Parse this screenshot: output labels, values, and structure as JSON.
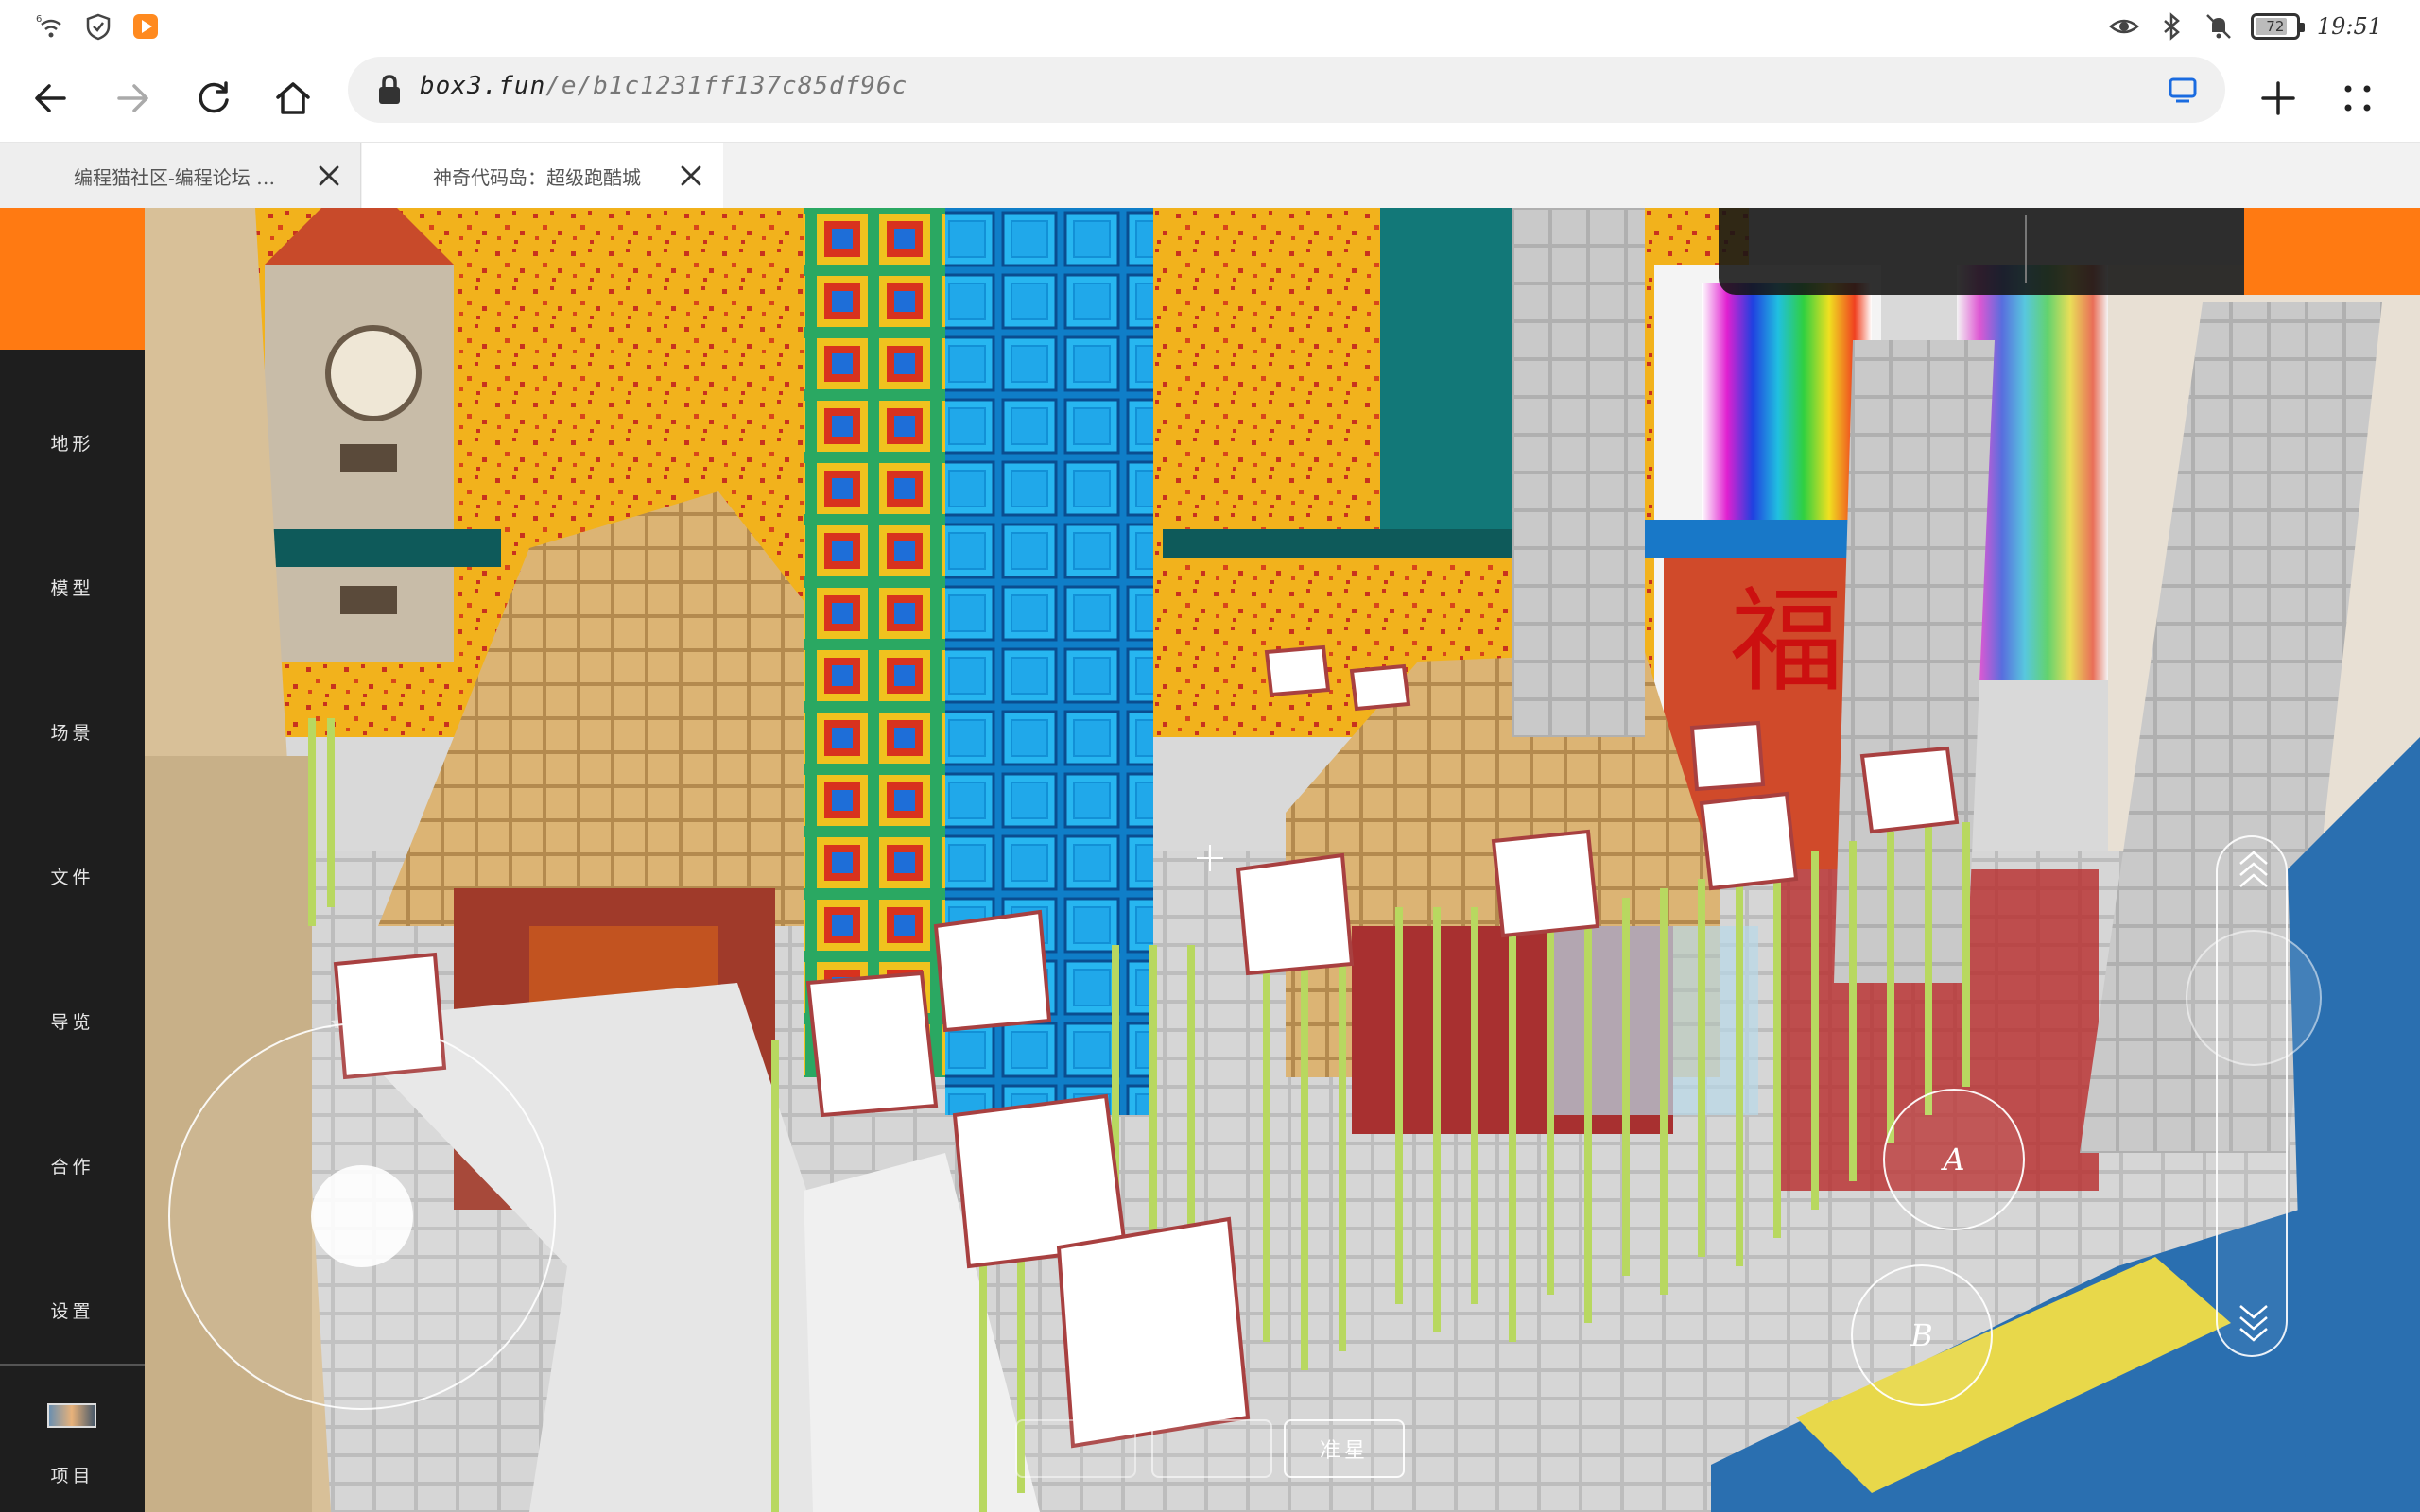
{
  "status_bar": {
    "signal_label": "6",
    "battery_level": "72",
    "battery_fraction": 0.72,
    "time": "19:51",
    "icons": [
      "wifi-icon",
      "shield-icon",
      "app-notification-icon",
      "eye-icon",
      "bluetooth-icon",
      "mute-icon",
      "battery-icon"
    ]
  },
  "browser": {
    "url_host": "box3.fun",
    "url_path": "/e/b1c1231ff137c85df96c",
    "tabs": [
      {
        "title": "编程猫社区-编程论坛 …"
      },
      {
        "title": "神奇代码岛：超级跑酷城"
      }
    ]
  },
  "side_panel": {
    "items": [
      {
        "label": "地形"
      },
      {
        "label": "模型"
      },
      {
        "label": "场景"
      },
      {
        "label": "文件"
      },
      {
        "label": "导览"
      },
      {
        "label": "合作"
      },
      {
        "label": "设置"
      }
    ],
    "project_label": "项目"
  },
  "controls": {
    "button_a": "A",
    "button_b": "B",
    "pills": [
      "",
      "",
      "准星"
    ]
  },
  "colors": {
    "accent_orange": "#ff7a12",
    "panel_dark": "#1e1e1e"
  }
}
